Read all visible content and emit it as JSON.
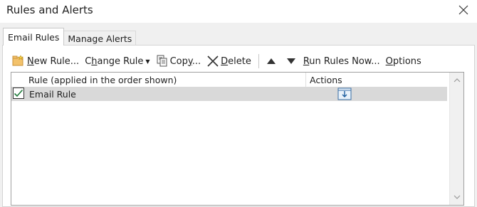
{
  "window": {
    "title": "Rules and Alerts"
  },
  "tabs": [
    {
      "label": "Email Rules",
      "active": true
    },
    {
      "label": "Manage Alerts",
      "active": false
    }
  ],
  "toolbar": {
    "new_rule": {
      "accel": "N",
      "rest": "ew Rule..."
    },
    "change_rule": {
      "accel": "h",
      "pre": "C",
      "rest": "ange Rule"
    },
    "copy": {
      "pre": "Cop",
      "accel": "y",
      "rest": "..."
    },
    "delete": {
      "accel": "D",
      "rest": "elete"
    },
    "run_rules": {
      "accel": "R",
      "rest": "un Rules Now..."
    },
    "options": {
      "accel": "O",
      "rest": "ptions"
    }
  },
  "list": {
    "columns": [
      "Rule (applied in the order shown)",
      "Actions"
    ],
    "rows": [
      {
        "checked": true,
        "name": "Email Rule",
        "action_icon": "move-to-folder-icon"
      }
    ]
  }
}
